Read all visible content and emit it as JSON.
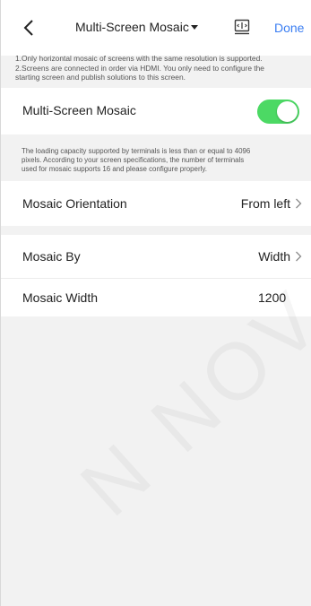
{
  "header": {
    "title": "Multi-Screen Mosaic",
    "done_label": "Done",
    "back_icon": "chevron-left-icon",
    "screen_icon": "screen-icon"
  },
  "info": {
    "lines": [
      "1.Only horizontal mosaic of screens with the same resolution is supported.",
      "2.Screens are connected in order via HDMI. You only need to configure the",
      "starting screen and publish solutions to this screen."
    ]
  },
  "mosaic": {
    "label": "Multi-Screen Mosaic",
    "enabled": true,
    "toggle_color": "#4cd964"
  },
  "capacity_note": {
    "lines": [
      "The loading capacity supported by terminals is less than or equal to 4096",
      "pixels. According to your screen specifications, the number of terminals",
      "used for mosaic supports 16 and please configure properly."
    ]
  },
  "orientation": {
    "label": "Mosaic Orientation",
    "value": "From left"
  },
  "mosaic_by": {
    "label": "Mosaic By",
    "value": "Width"
  },
  "mosaic_width": {
    "label": "Mosaic Width",
    "value": "1200"
  },
  "watermark": {
    "text": "N NOV"
  },
  "colors": {
    "accent": "#3b7ef2",
    "toggle_on": "#4cd964",
    "background": "#f2f2f2"
  }
}
